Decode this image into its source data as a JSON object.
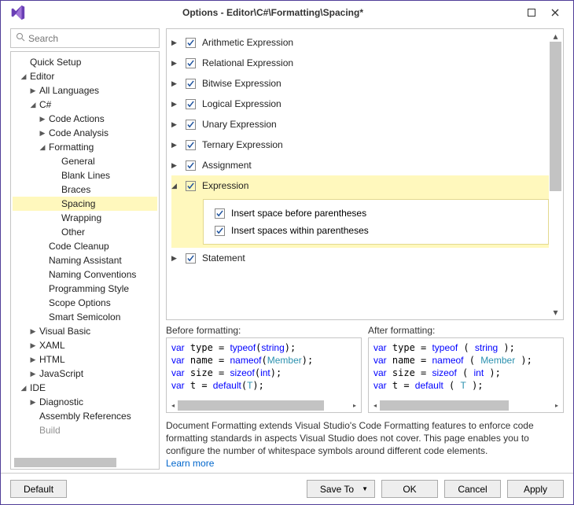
{
  "title": "Options - Editor\\C#\\Formatting\\Spacing*",
  "search_placeholder": "Search",
  "tree": {
    "quick_setup": "Quick Setup",
    "editor": "Editor",
    "all_lang": "All Languages",
    "csharp": "C#",
    "code_actions": "Code Actions",
    "code_analysis": "Code Analysis",
    "formatting": "Formatting",
    "general": "General",
    "blank_lines": "Blank Lines",
    "braces": "Braces",
    "spacing": "Spacing",
    "wrapping": "Wrapping",
    "other": "Other",
    "code_cleanup": "Code Cleanup",
    "naming_assistant": "Naming Assistant",
    "naming_conventions": "Naming Conventions",
    "programming_style": "Programming Style",
    "scope_options": "Scope Options",
    "smart_semicolon": "Smart Semicolon",
    "visual_basic": "Visual Basic",
    "xaml": "XAML",
    "html": "HTML",
    "javascript": "JavaScript",
    "ide": "IDE",
    "diagnostic": "Diagnostic",
    "assembly_references": "Assembly References",
    "build": "Build"
  },
  "options": {
    "arithmetic": "Arithmetic Expression",
    "relational": "Relational Expression",
    "bitwise": "Bitwise Expression",
    "logical": "Logical Expression",
    "unary": "Unary Expression",
    "ternary": "Ternary Expression",
    "assignment": "Assignment",
    "expression": "Expression",
    "insert_before": "Insert space before parentheses",
    "insert_within": "Insert spaces within parentheses",
    "statement": "Statement"
  },
  "preview": {
    "before_label": "Before formatting:",
    "after_label": "After formatting:"
  },
  "desc_text": "Document Formatting extends Visual Studio's Code Formatting features to enforce code formatting standards in aspects Visual Studio does not cover. This page enables you to configure the number of whitespace symbols around different code elements.",
  "learn_more": "Learn more",
  "buttons": {
    "default": "Default",
    "save_to": "Save To",
    "ok": "OK",
    "cancel": "Cancel",
    "apply": "Apply"
  }
}
